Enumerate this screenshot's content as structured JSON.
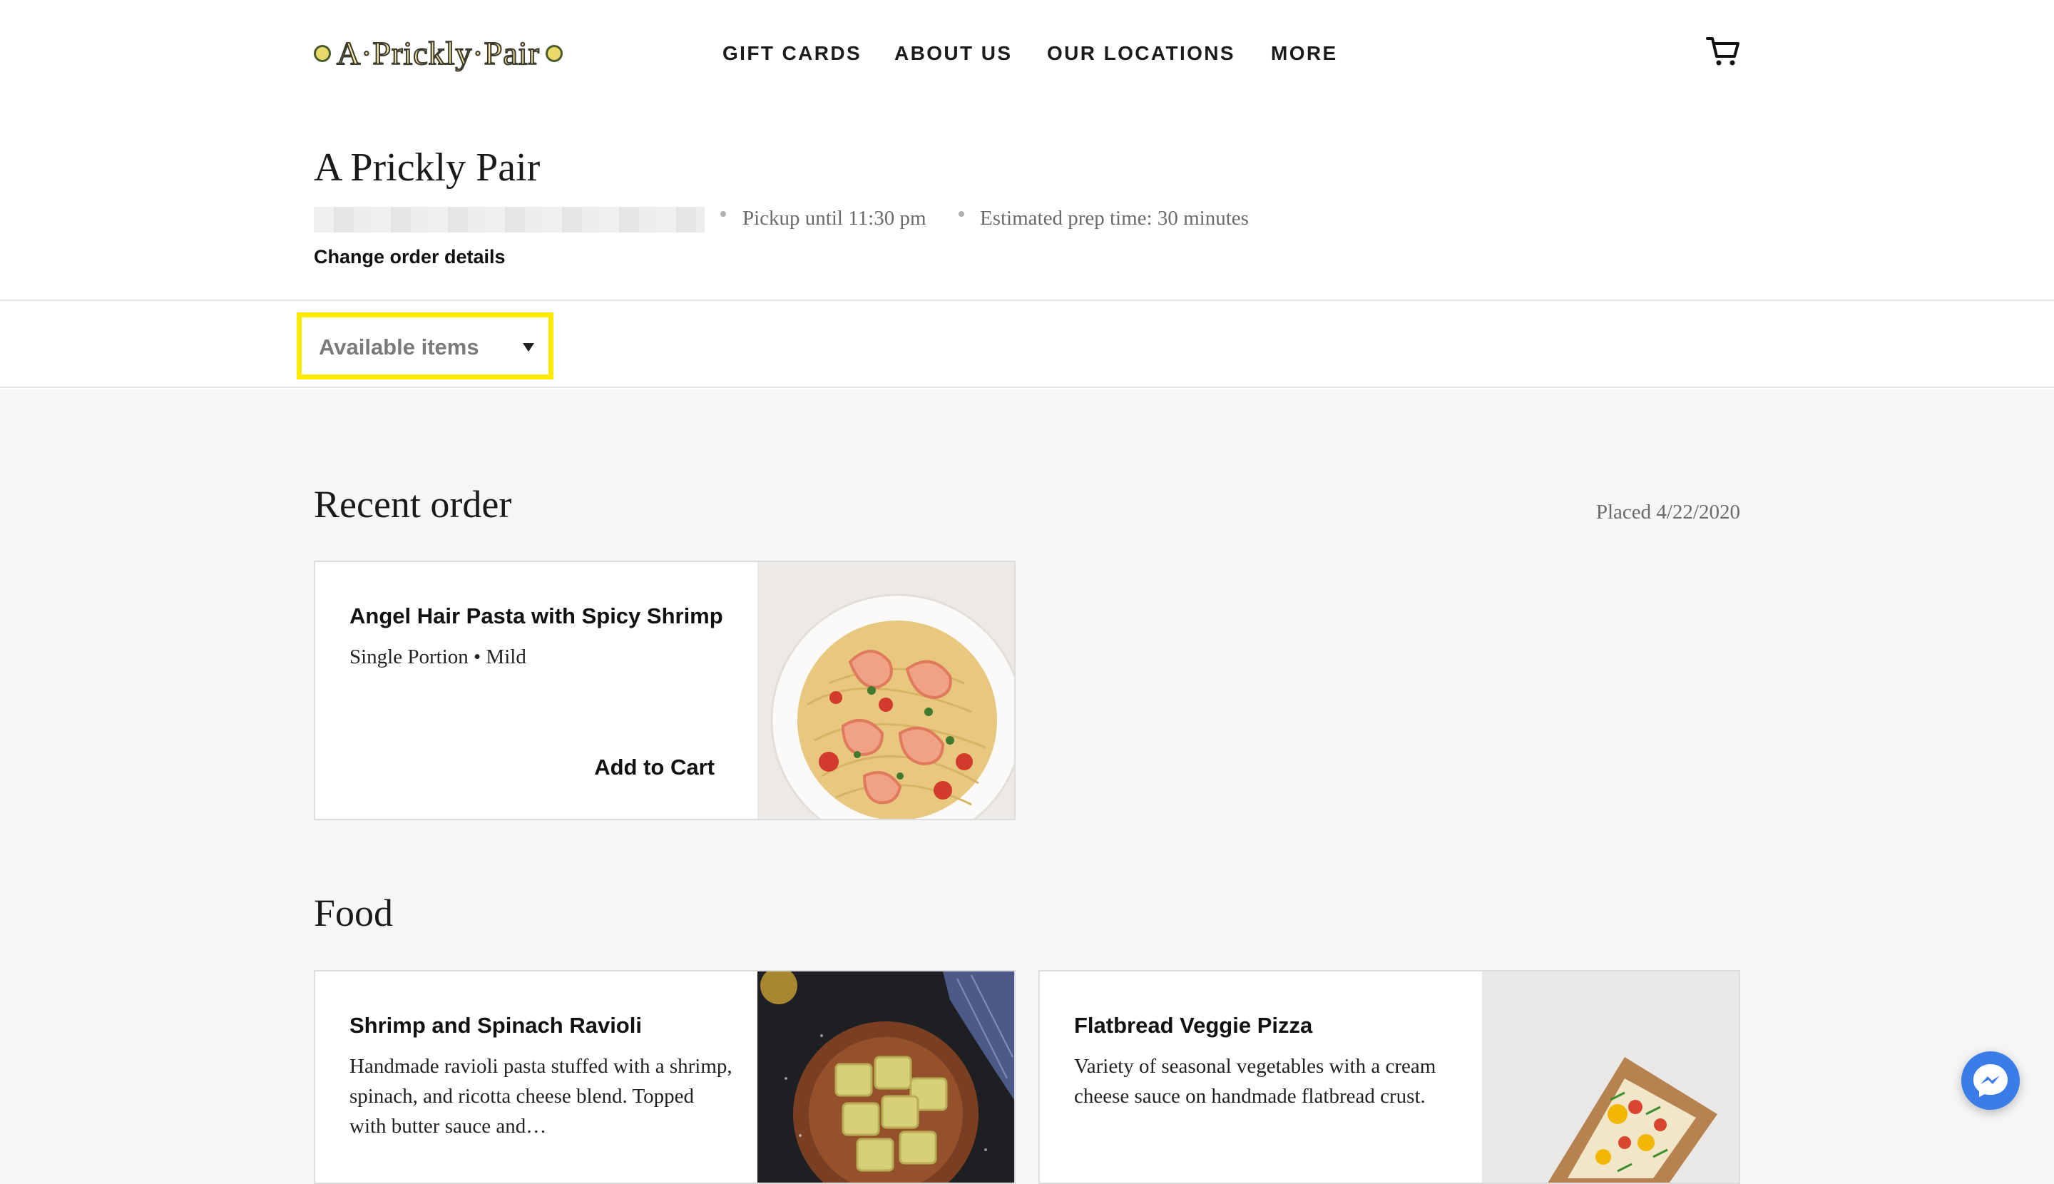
{
  "header": {
    "logo_text": "A·Prickly·Pair",
    "nav": [
      "GIFT CARDS",
      "ABOUT US",
      "OUR LOCATIONS",
      "MORE"
    ],
    "cart_icon": "cart-icon"
  },
  "restaurant": {
    "name": "A Prickly Pair",
    "pickup": "Pickup until 11:30 pm",
    "prep_time": "Estimated prep time: 30 minutes",
    "change_link": "Change order details"
  },
  "filter": {
    "label": "Available items",
    "icon": "caret-down-icon",
    "highlight_color": "#ffeb00"
  },
  "recent_order": {
    "title": "Recent order",
    "placed": "Placed 4/22/2020",
    "item": {
      "name": "Angel Hair Pasta with Spicy Shrimp",
      "options": "Single Portion • Mild",
      "action": "Add to Cart"
    }
  },
  "food": {
    "title": "Food",
    "items": [
      {
        "name": "Shrimp and Spinach Ravioli",
        "description": "Handmade ravioli pasta stuffed with a shrimp, spinach, and ricotta cheese blend. Topped with butter sauce and…"
      },
      {
        "name": "Flatbread Veggie Pizza",
        "description": "Variety of seasonal vegetables with a cream cheese sauce on handmade flatbread crust."
      }
    ]
  },
  "chat_icon": "messenger-icon"
}
